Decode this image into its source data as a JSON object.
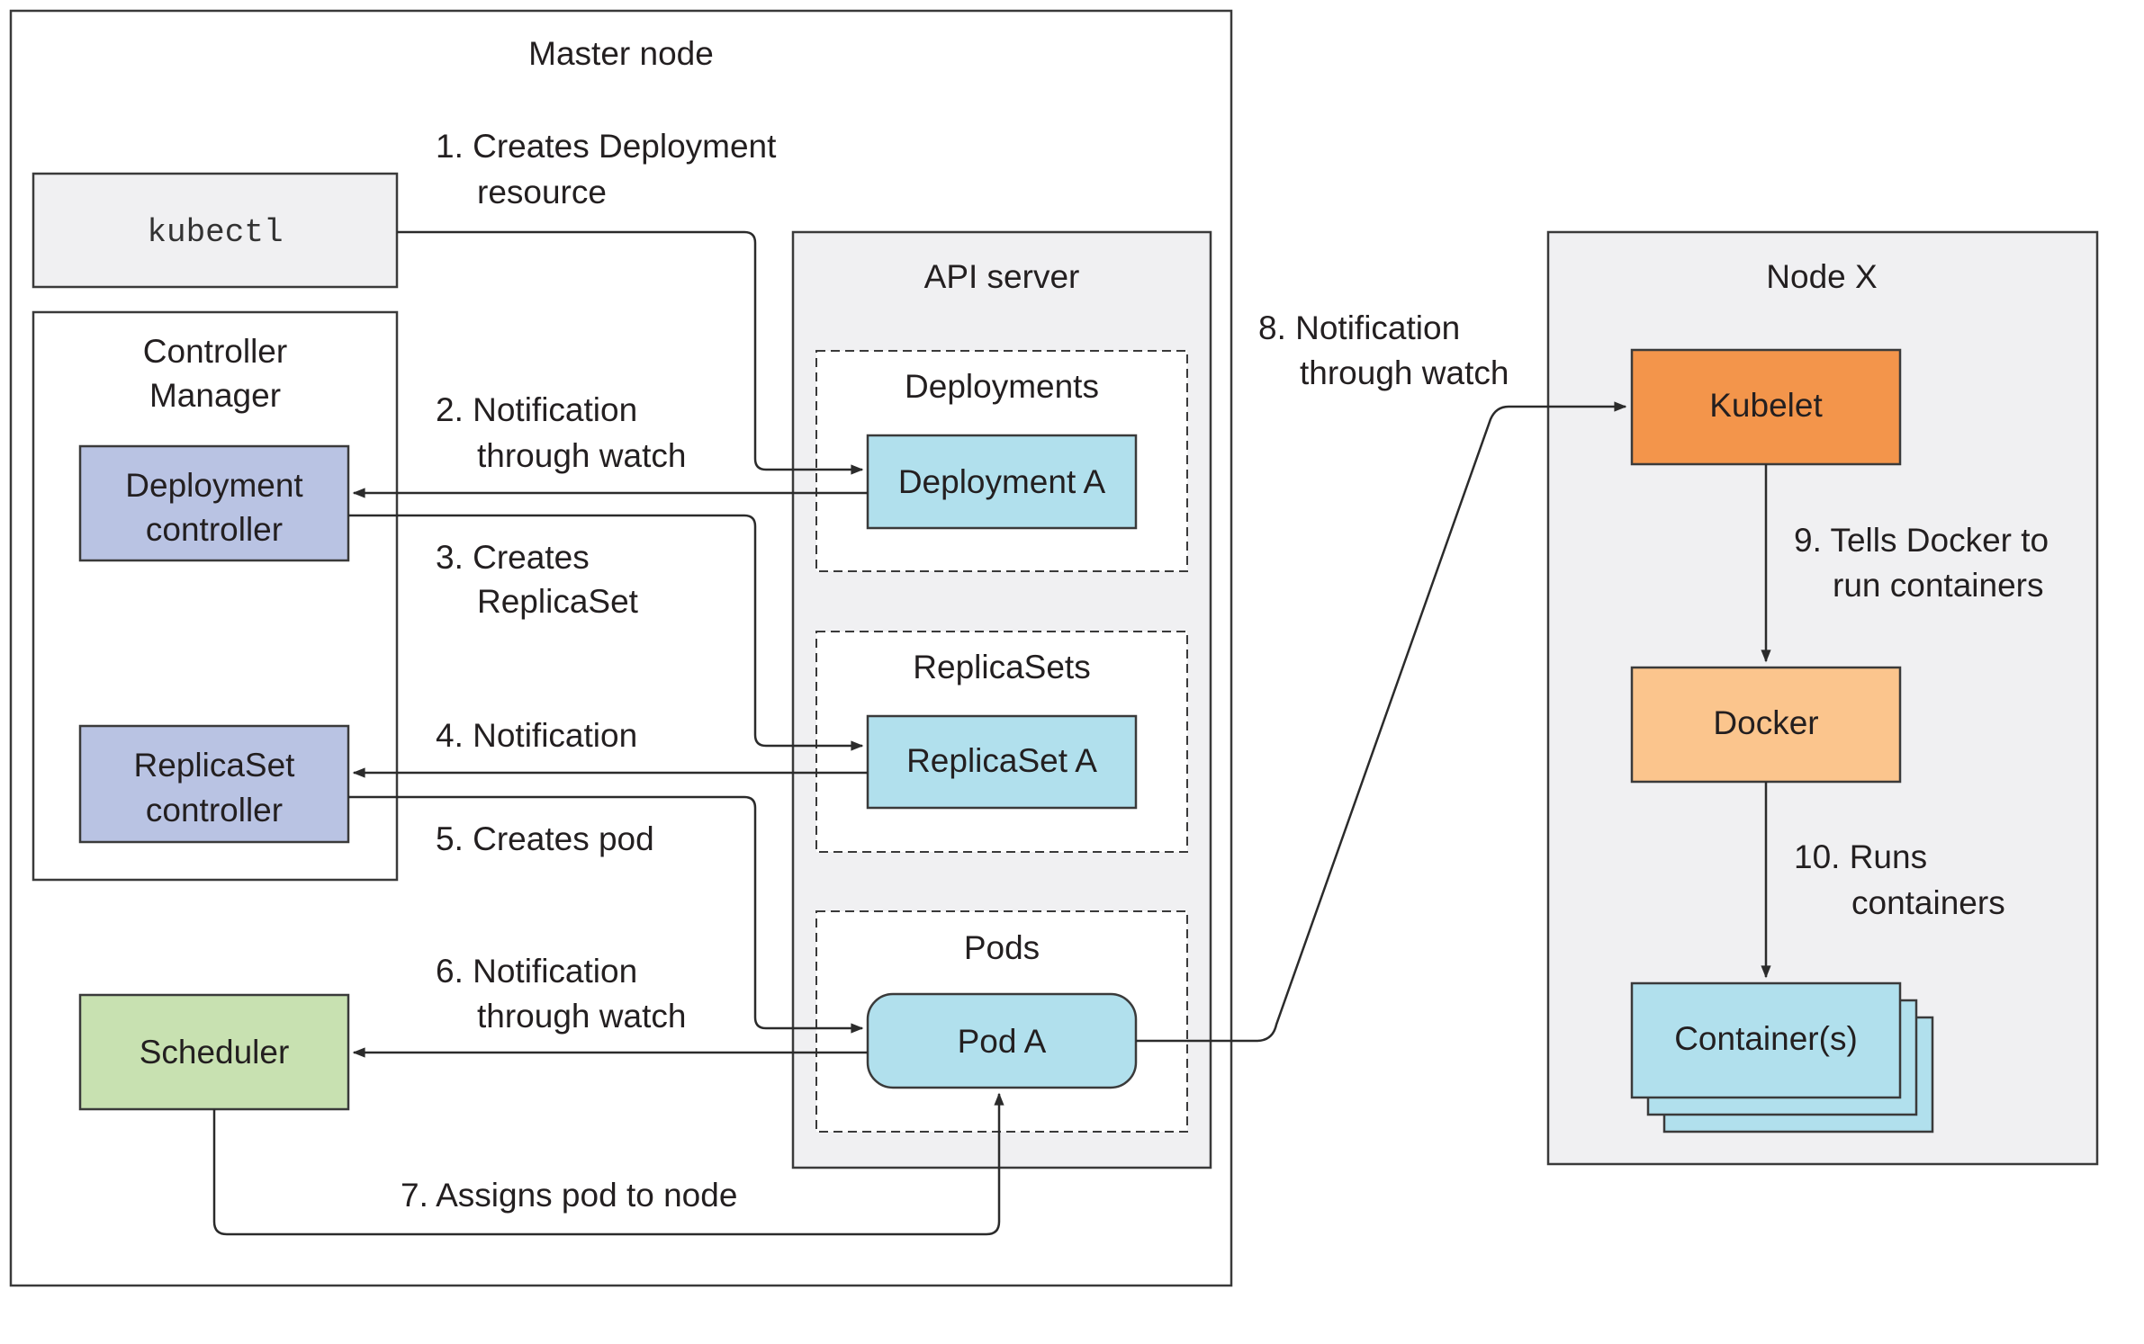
{
  "colors": {
    "frame_gray": "#f0f0f2",
    "resource_blue": "#b1e0ed",
    "controller_purple": "#b9c3e3",
    "scheduler_green": "#c8e1b1",
    "kubelet_orange": "#f3954b",
    "docker_peach": "#fbc58d",
    "line": "#2b2b2b"
  },
  "master_node": {
    "title": "Master node",
    "kubectl": "kubectl",
    "controller_manager": {
      "title_line1": "Controller",
      "title_line2": "Manager"
    },
    "deployment_controller": {
      "line1": "Deployment",
      "line2": "controller"
    },
    "replicaset_controller": {
      "line1": "ReplicaSet",
      "line2": "controller"
    },
    "scheduler": "Scheduler",
    "api_server": {
      "title": "API server",
      "deployments": {
        "title": "Deployments",
        "item": "Deployment A"
      },
      "replicasets": {
        "title": "ReplicaSets",
        "item": "ReplicaSet A"
      },
      "pods": {
        "title": "Pods",
        "item": "Pod A"
      }
    }
  },
  "node_x": {
    "title": "Node X",
    "kubelet": "Kubelet",
    "docker": "Docker",
    "containers": "Container(s)"
  },
  "steps": [
    {
      "line1": "1. Creates Deployment",
      "line2": "resource"
    },
    {
      "line1": "2. Notification",
      "line2": "through watch"
    },
    {
      "line1": "3. Creates",
      "line2": "ReplicaSet"
    },
    {
      "line1": "4. Notification",
      "line2": ""
    },
    {
      "line1": "5. Creates pod",
      "line2": ""
    },
    {
      "line1": "6. Notification",
      "line2": "through watch"
    },
    {
      "line1": "7. Assigns pod to node",
      "line2": ""
    },
    {
      "line1": "8. Notification",
      "line2": "through watch"
    },
    {
      "line1": "9. Tells Docker to",
      "line2": "run containers"
    },
    {
      "line1": "10. Runs",
      "line2": "containers"
    }
  ]
}
